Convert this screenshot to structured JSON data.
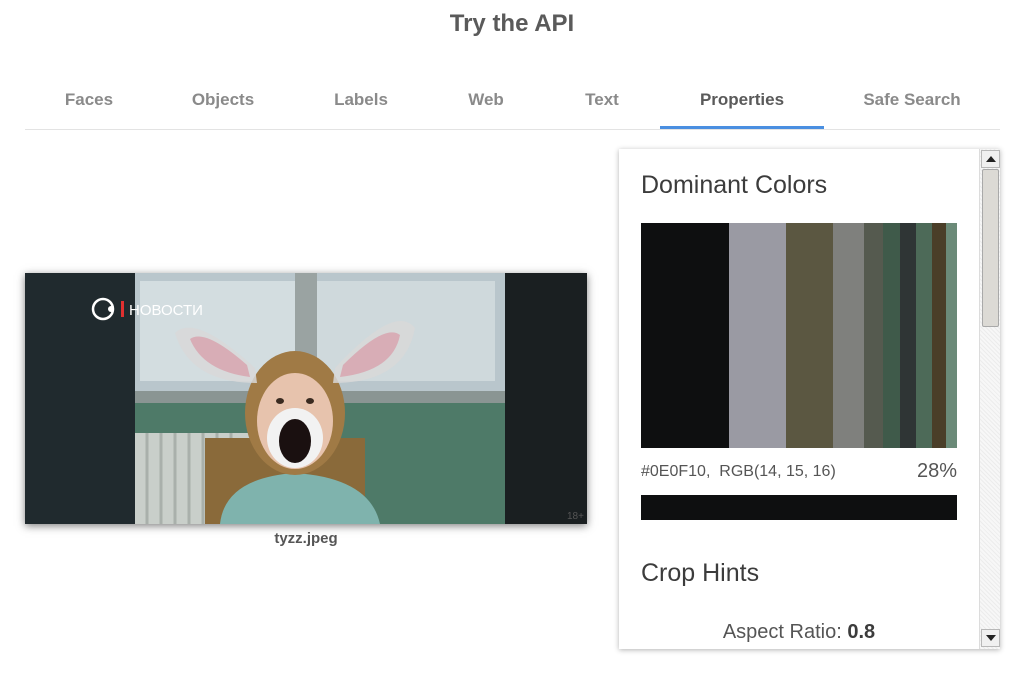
{
  "header": {
    "title": "Try the API"
  },
  "tabs": [
    {
      "label": "Faces",
      "active": false
    },
    {
      "label": "Objects",
      "active": false
    },
    {
      "label": "Labels",
      "active": false
    },
    {
      "label": "Web",
      "active": false
    },
    {
      "label": "Text",
      "active": false
    },
    {
      "label": "Properties",
      "active": true
    },
    {
      "label": "Safe Search",
      "active": false
    }
  ],
  "image": {
    "filename": "tyzz.jpeg",
    "watermark_text": "НОВОСТИ",
    "age_badge": "18+"
  },
  "properties": {
    "dominant_colors_title": "Dominant Colors",
    "colors": [
      {
        "hex": "#0E0F10",
        "fraction": 0.28
      },
      {
        "hex": "#9A9AA3",
        "fraction": 0.18
      },
      {
        "hex": "#5B5741",
        "fraction": 0.15
      },
      {
        "hex": "#7F807D",
        "fraction": 0.1
      },
      {
        "hex": "#555A4F",
        "fraction": 0.06
      },
      {
        "hex": "#3F5A4A",
        "fraction": 0.055
      },
      {
        "hex": "#2F3535",
        "fraction": 0.05
      },
      {
        "hex": "#4D6A58",
        "fraction": 0.05
      },
      {
        "hex": "#4A3E28",
        "fraction": 0.045
      },
      {
        "hex": "#6B8A78",
        "fraction": 0.035
      }
    ],
    "selected_color": {
      "hex_label": "#0E0F10,",
      "rgb_label": "RGB(14, 15, 16)",
      "percent": "28%",
      "swatch": "#0E0F10"
    },
    "crop_hints_title": "Crop Hints",
    "aspect_label": "Aspect Ratio:",
    "aspect_value": "0.8"
  },
  "colors": {
    "accent": "#4A8FE1"
  }
}
